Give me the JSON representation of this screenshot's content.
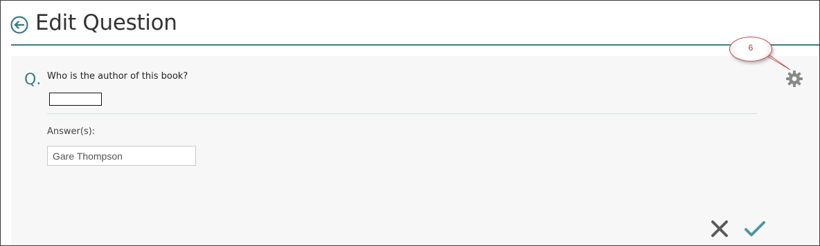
{
  "header": {
    "title": "Edit Question",
    "back_icon": "circle-arrow-left-icon"
  },
  "question": {
    "prefix": "Q.",
    "text": "Who is the author of this book?"
  },
  "answers": {
    "label": "Answer(s):",
    "value": "Gare Thompson"
  },
  "settings": {
    "icon": "gear-icon"
  },
  "annotation": {
    "number": "6"
  },
  "actions": {
    "cancel_icon": "close-icon",
    "save_icon": "checkmark-icon"
  },
  "colors": {
    "accent": "#3b7c85",
    "panel_bg": "#f7f7f7",
    "icon_gray": "#8a8a8a",
    "cancel_gray": "#5a5a5a",
    "save_teal": "#4a98a3",
    "callout_red": "#c4302b"
  }
}
